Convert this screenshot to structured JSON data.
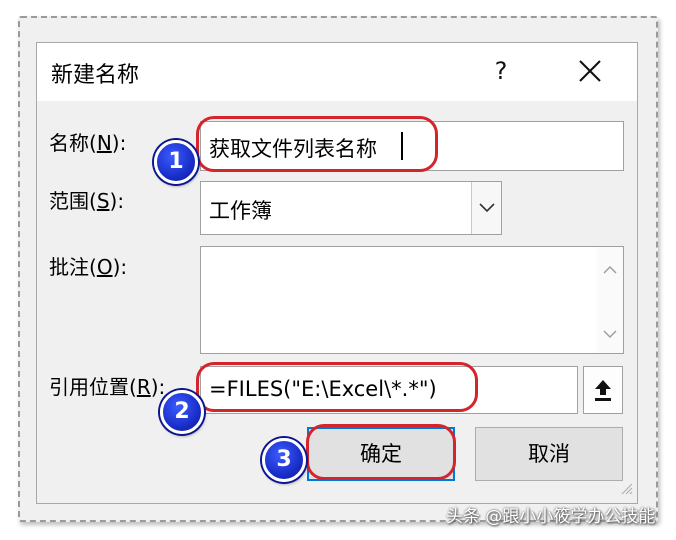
{
  "dialog": {
    "title": "新建名称",
    "help_label": "?",
    "close_icon": "close-icon"
  },
  "fields": {
    "name": {
      "label_pre": "名称(",
      "label_accel": "N",
      "label_post": "):",
      "value": "获取文件列表名称"
    },
    "scope": {
      "label_pre": "范围(",
      "label_accel": "S",
      "label_post": "):",
      "value": "工作簿"
    },
    "comment": {
      "label_pre": "批注(",
      "label_accel": "O",
      "label_post": "):",
      "value": ""
    },
    "refers_to": {
      "label_pre": "引用位置(",
      "label_accel": "R",
      "label_post": "):",
      "value": "=FILES(\"E:\\Excel\\*.*\")"
    }
  },
  "buttons": {
    "ok": "确定",
    "cancel": "取消"
  },
  "annotations": {
    "badge_1": "1",
    "badge_2": "2",
    "badge_3": "3",
    "oval_color": "#d3252b",
    "badge_color": "#1a2fc9"
  },
  "watermark": "头条 @跟小小筱学办公技能"
}
